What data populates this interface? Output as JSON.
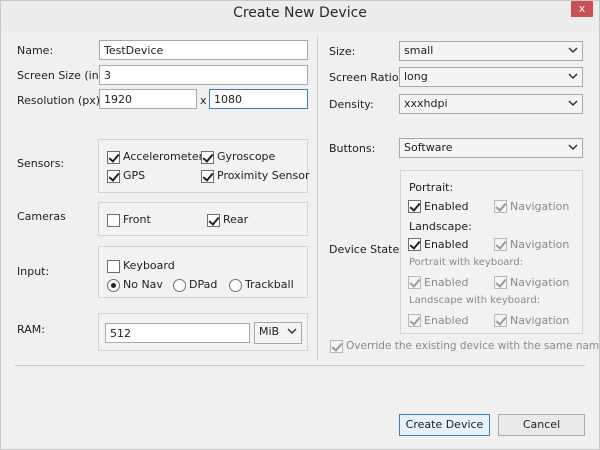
{
  "window": {
    "title": "Create New Device",
    "close": "x"
  },
  "form": {
    "name_label": "Name:",
    "name_value": "TestDevice",
    "screen_size_label": "Screen Size (in):",
    "screen_size_value": "3",
    "resolution_label": "Resolution (px):",
    "resolution_w": "1920",
    "resolution_sep": "x",
    "resolution_h": "1080",
    "sensors_label": "Sensors:",
    "sensors": {
      "accelerometer": "Accelerometer",
      "gyroscope": "Gyroscope",
      "gps": "GPS",
      "proximity": "Proximity Sensor"
    },
    "cameras_label": "Cameras",
    "cameras": {
      "front": "Front",
      "rear": "Rear"
    },
    "input_label": "Input:",
    "input": {
      "keyboard": "Keyboard",
      "no_nav": "No Nav",
      "dpad": "DPad",
      "trackball": "Trackball"
    },
    "ram_label": "RAM:",
    "ram_value": "512",
    "ram_unit": "MiB"
  },
  "right": {
    "size_label": "Size:",
    "size_value": "small",
    "ratio_label": "Screen Ratio:",
    "ratio_value": "long",
    "density_label": "Density:",
    "density_value": "xxxhdpi",
    "buttons_label": "Buttons:",
    "buttons_value": "Software",
    "states_label": "Device States:",
    "portrait": "Portrait:",
    "landscape": "Landscape:",
    "portrait_kb": "Portrait with keyboard:",
    "landscape_kb": "Landscape with keyboard:",
    "enabled": "Enabled",
    "navigation": "Navigation",
    "override": "Override the existing device with the same name"
  },
  "actions": {
    "create": "Create Device",
    "cancel": "Cancel"
  }
}
